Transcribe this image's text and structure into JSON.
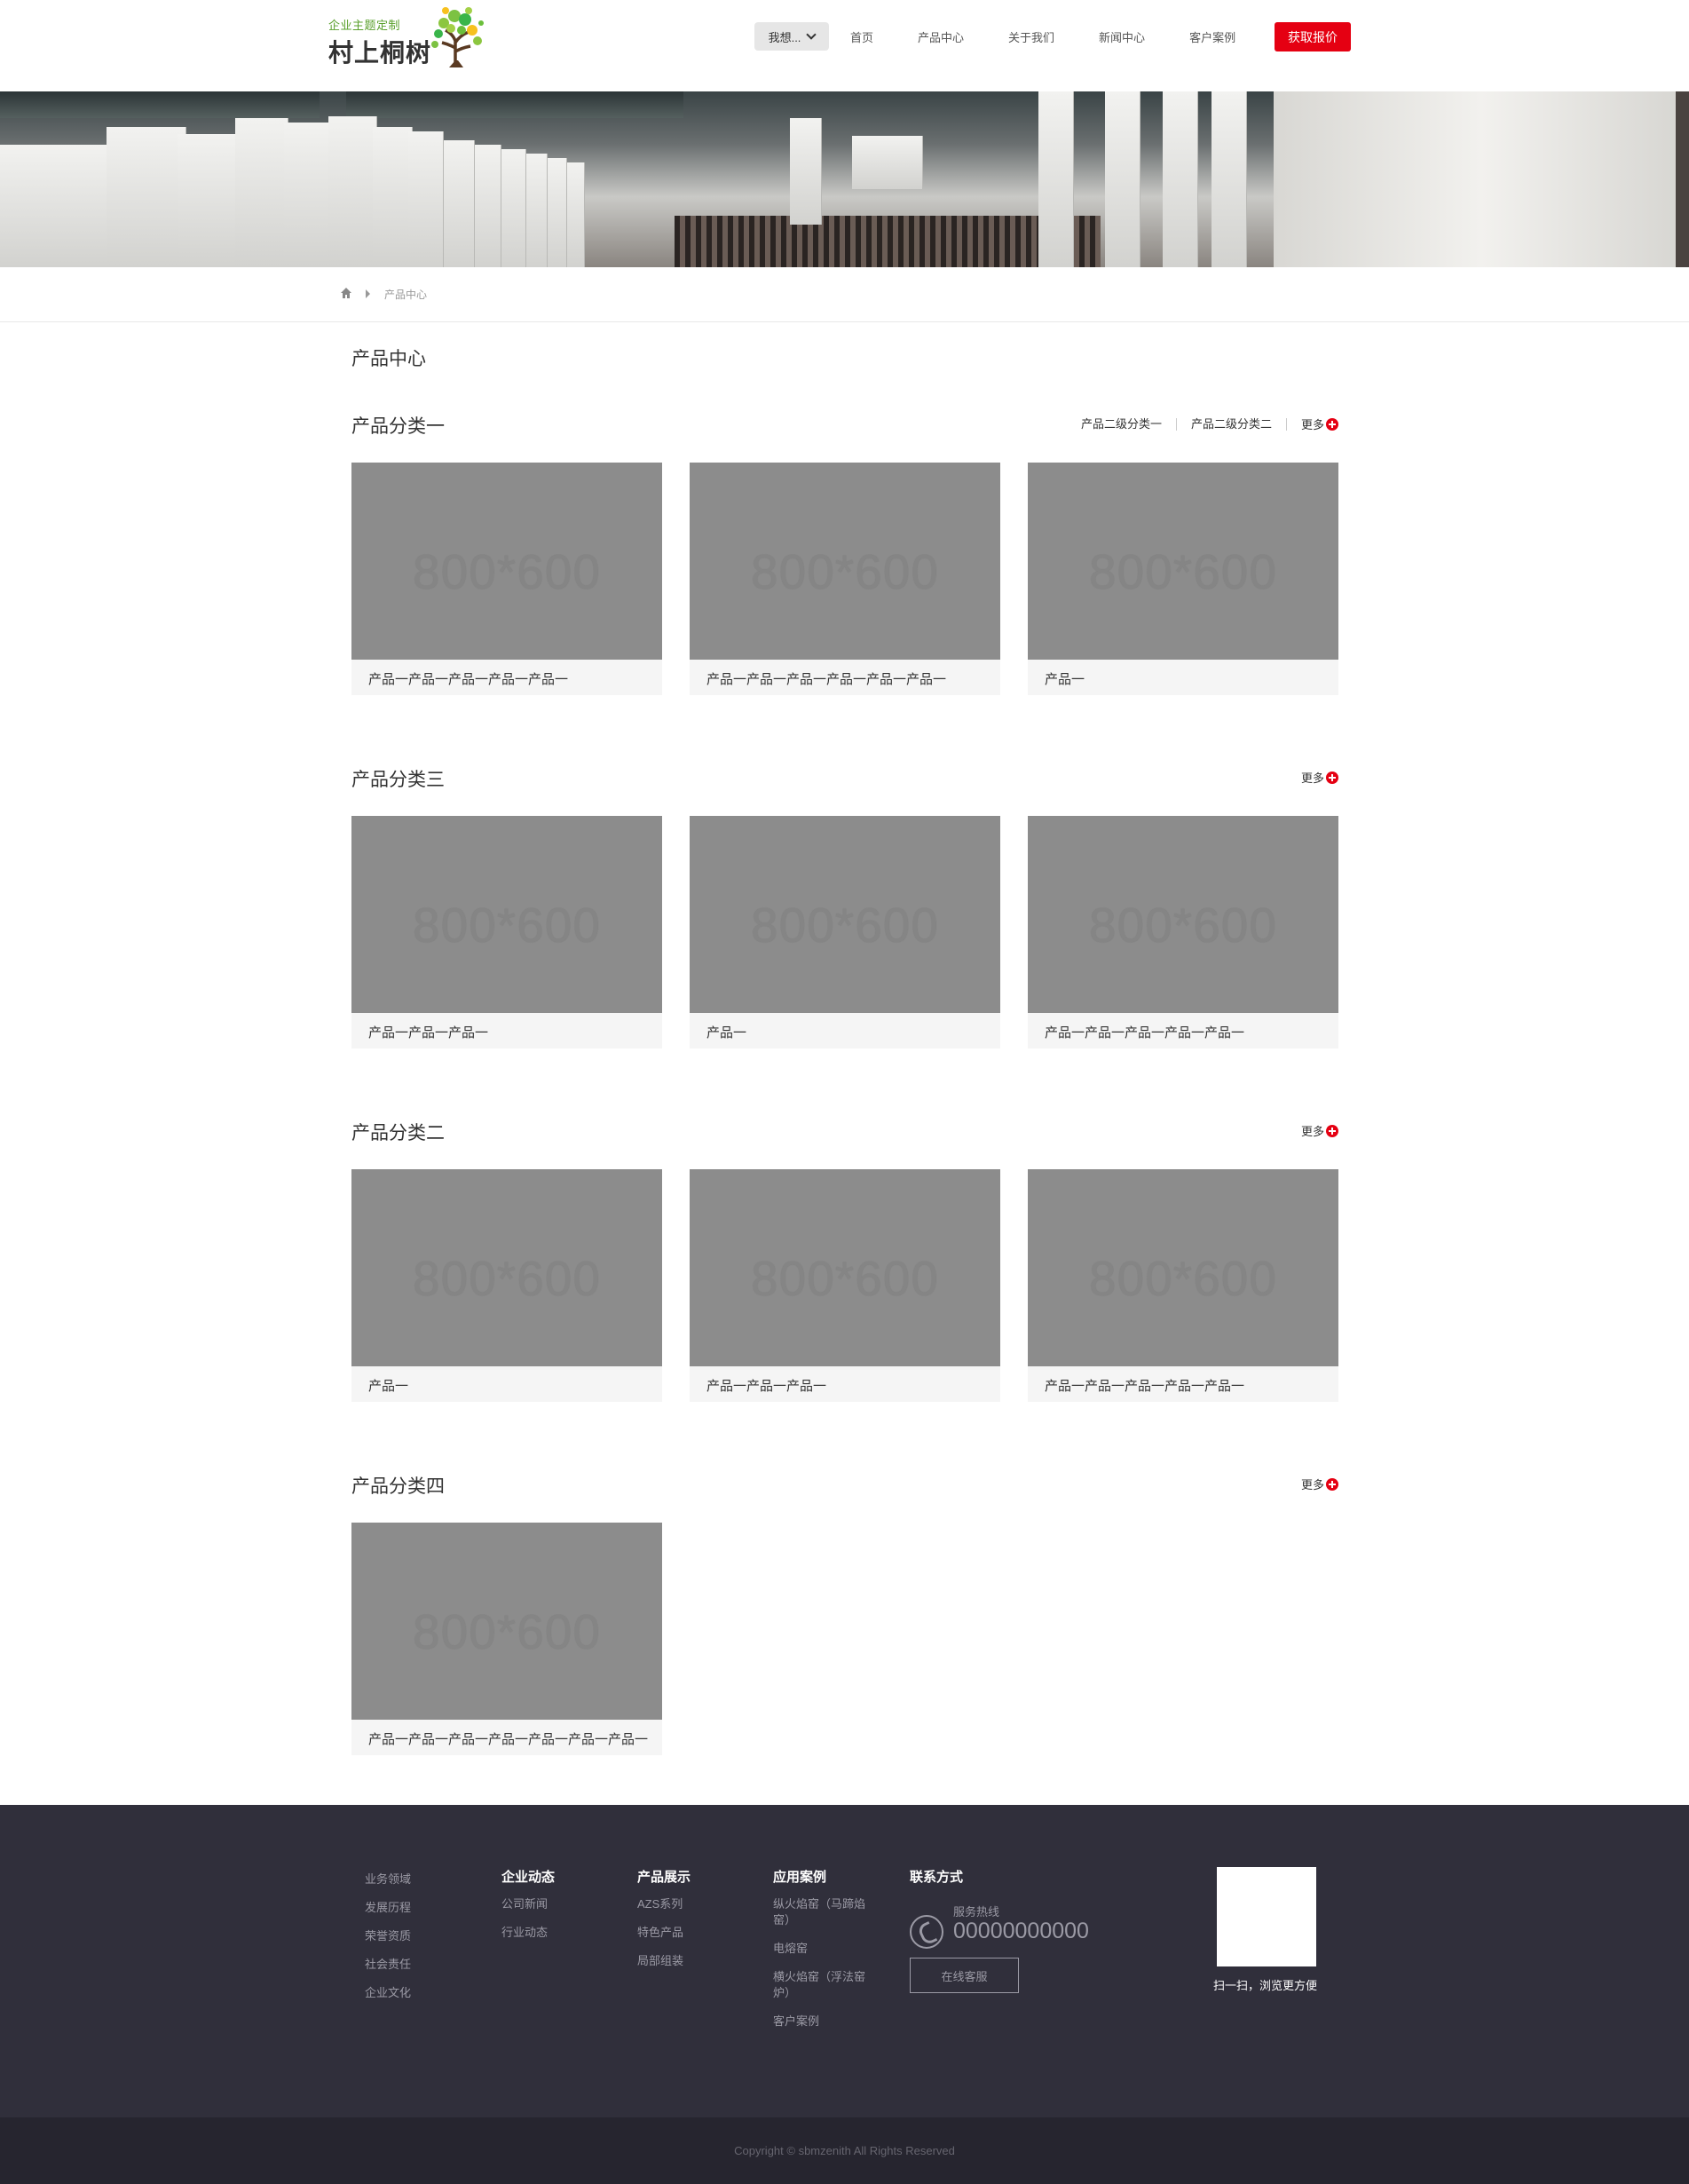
{
  "header": {
    "logo_tagline": "企业主题定制",
    "logo_name": "村上桐树",
    "nav_want": "我想...",
    "nav_items": [
      "首页",
      "产品中心",
      "关于我们",
      "新闻中心",
      "客户案例"
    ],
    "quote_button": "获取报价",
    "accent_color": "#e50012"
  },
  "breadcrumb": {
    "current": "产品中心"
  },
  "main": {
    "page_title": "产品中心",
    "image_placeholder": "800*600",
    "more_label": "更多",
    "sections": [
      {
        "title": "产品分类一",
        "sub_links": [
          "产品二级分类一",
          "产品二级分类二"
        ],
        "products": [
          "产品一产品一产品一产品一产品一",
          "产品一产品一产品一产品一产品一产品一",
          "产品一"
        ]
      },
      {
        "title": "产品分类三",
        "sub_links": [],
        "products": [
          "产品一产品一产品一",
          "产品一",
          "产品一产品一产品一产品一产品一"
        ]
      },
      {
        "title": "产品分类二",
        "sub_links": [],
        "products": [
          "产品一",
          "产品一产品一产品一",
          "产品一产品一产品一产品一产品一"
        ]
      },
      {
        "title": "产品分类四",
        "sub_links": [],
        "products": [
          "产品一产品一产品一产品一产品一产品一产品一"
        ]
      }
    ]
  },
  "footer": {
    "col1_items": [
      "业务领域",
      "发展历程",
      "荣誉资质",
      "社会责任",
      "企业文化"
    ],
    "col2": {
      "title": "企业动态",
      "items": [
        "公司新闻",
        "行业动态"
      ]
    },
    "col3": {
      "title": "产品展示",
      "items": [
        "AZS系列",
        "特色产品",
        "局部组装"
      ]
    },
    "col4": {
      "title": "应用案例",
      "items": [
        "纵火焰窑（马蹄焰窑）",
        "电熔窑",
        "横火焰窑（浮法窑炉）",
        "客户案例"
      ]
    },
    "contact": {
      "title": "联系方式",
      "hotline_label": "服务热线",
      "hotline_number": "00000000000",
      "online_service": "在线客服"
    },
    "qr_caption": "扫一扫，浏览更方便",
    "copyright": "Copyright © sbmzenith All Rights Reserved"
  }
}
